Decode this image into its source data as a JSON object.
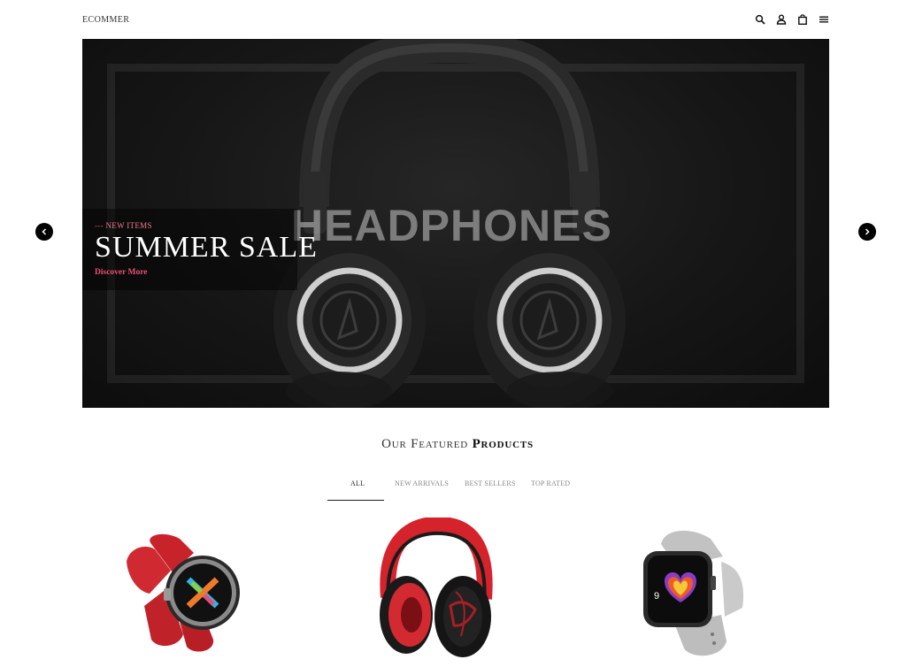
{
  "header": {
    "logo": "ECOMMER",
    "icons": [
      "search-icon",
      "user-icon",
      "bag-icon",
      "menu-icon"
    ]
  },
  "hero": {
    "kicker_prefix": "---",
    "kicker": "NEW ITEMS",
    "title": "SUMMER SALE",
    "link": "Discover More",
    "background_word": "HEADPHONES",
    "accent_color": "#ec4f78"
  },
  "slider": {
    "prev_icon": "chevron-left-icon",
    "next_icon": "chevron-right-icon"
  },
  "featured": {
    "title_light": "Our Featured",
    "title_bold": "Products",
    "tabs": [
      {
        "label": "ALL",
        "active": true
      },
      {
        "label": "NEW ARRIVALS",
        "active": false
      },
      {
        "label": "BEST SELLERS",
        "active": false
      },
      {
        "label": "TOP RATED",
        "active": false
      }
    ]
  },
  "products": [
    {
      "image": "red-smartwatch-image"
    },
    {
      "image": "red-headphones-image"
    },
    {
      "image": "grey-smartwatch-image"
    }
  ]
}
